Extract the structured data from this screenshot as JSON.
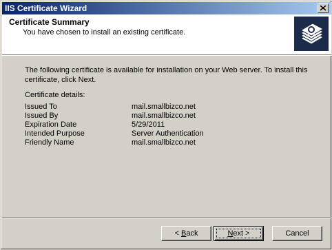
{
  "window": {
    "title": "IIS Certificate Wizard"
  },
  "header": {
    "title": "Certificate Summary",
    "subtitle": "You have chosen to install an existing certificate."
  },
  "body": {
    "intro": "The following certificate is available for installation on your Web server. To install this certificate, click Next.",
    "details_label": "Certificate details:",
    "details": [
      {
        "key": "Issued To",
        "value": "mail.smallbizco.net"
      },
      {
        "key": "Issued By",
        "value": "mail.smallbizco.net"
      },
      {
        "key": "Expiration Date",
        "value": "5/29/2011"
      },
      {
        "key": "Intended Purpose",
        "value": "Server Authentication"
      },
      {
        "key": "Friendly Name",
        "value": "mail.smallbizco.net"
      }
    ]
  },
  "buttons": {
    "back": {
      "prefix": "< ",
      "accel": "B",
      "rest": "ack"
    },
    "next": {
      "accel": "N",
      "rest": "ext >"
    },
    "cancel": "Cancel"
  },
  "icons": {
    "close": "close-icon",
    "logo": "certificate-wizard-logo-icon"
  },
  "colors": {
    "titlebar_start": "#0a246a",
    "titlebar_end": "#a6caf0",
    "face": "#d4d0c8"
  }
}
